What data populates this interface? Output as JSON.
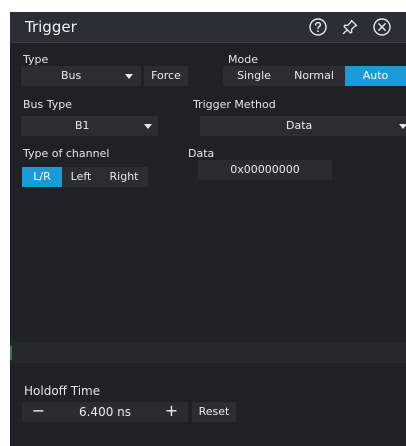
{
  "window": {
    "title": "Trigger",
    "icons": [
      "help-icon",
      "pin-icon",
      "close-icon"
    ]
  },
  "type": {
    "label": "Type",
    "value": "Bus",
    "force_label": "Force"
  },
  "mode": {
    "label": "Mode",
    "options": [
      "Single",
      "Normal",
      "Auto"
    ],
    "selected": "Auto"
  },
  "bus_type": {
    "label": "Bus Type",
    "value": "B1"
  },
  "trigger_method": {
    "label": "Trigger Method",
    "value": "Data"
  },
  "channel_type": {
    "label": "Type of channel",
    "options": [
      "L/R",
      "Left",
      "Right"
    ],
    "selected": "L/R"
  },
  "data": {
    "label": "Data",
    "value": "0x00000000"
  },
  "holdoff": {
    "label": "Holdoff Time",
    "minus": "−",
    "value": "6.400 ns",
    "plus": "+",
    "reset_label": "Reset"
  },
  "colors": {
    "accent": "#1a9ad6",
    "panel": "#1f2126",
    "control": "#2b2d33"
  }
}
